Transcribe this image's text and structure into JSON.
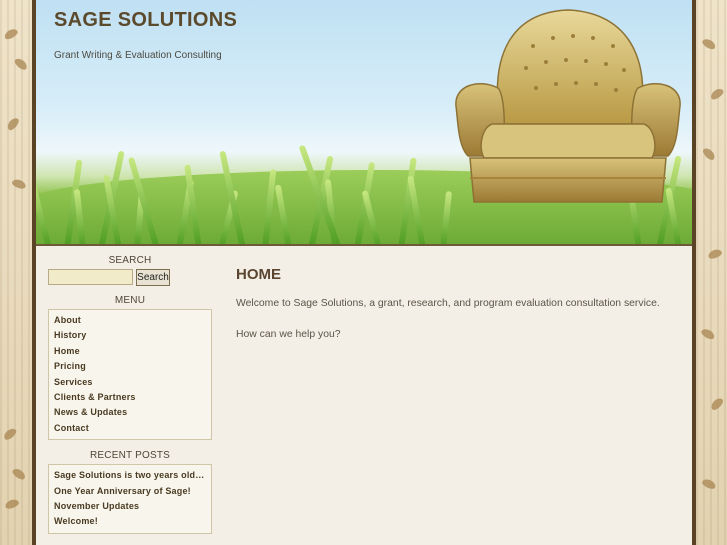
{
  "site": {
    "title": "SAGE SOLUTIONS",
    "tagline": "Grant Writing & Evaluation Consulting"
  },
  "search": {
    "title": "SEARCH",
    "value": "",
    "button_label": "Search"
  },
  "menu": {
    "title": "MENU",
    "items": [
      {
        "label": "About"
      },
      {
        "label": "History"
      },
      {
        "label": "Home"
      },
      {
        "label": "Pricing"
      },
      {
        "label": "Services"
      },
      {
        "label": "Clients & Partners"
      },
      {
        "label": "News & Updates"
      },
      {
        "label": "Contact"
      }
    ]
  },
  "recent_posts": {
    "title": "RECENT POSTS",
    "items": [
      {
        "label": "Sage Solutions is two years old…"
      },
      {
        "label": "One Year Anniversary of Sage!"
      },
      {
        "label": "November Updates"
      },
      {
        "label": "Welcome!"
      }
    ]
  },
  "main": {
    "heading": "HOME",
    "paragraphs": [
      "Welcome to Sage Solutions, a grant, research, and program evaluation consultation service.",
      "How can we help you?"
    ]
  },
  "colors": {
    "accent": "#5a4530",
    "border": "#5a4425",
    "page_bg": "#f3efe6"
  }
}
